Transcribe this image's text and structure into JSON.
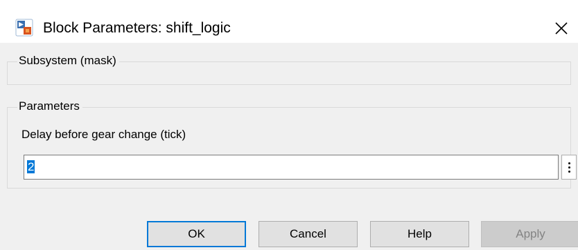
{
  "window": {
    "title": "Block Parameters: shift_logic",
    "app_icon": "simulink-block-icon",
    "close_icon": "close-icon"
  },
  "subsystem_group": {
    "legend": "Subsystem (mask)"
  },
  "parameters_group": {
    "legend": "Parameters",
    "delay_label": "Delay before gear change (tick)",
    "delay_value": "2",
    "more_icon": "vertical-ellipsis-icon"
  },
  "buttons": {
    "ok": "OK",
    "cancel": "Cancel",
    "help": "Help",
    "apply": "Apply"
  },
  "colors": {
    "selection": "#0078d7",
    "default_button_border": "#0078d7",
    "disabled_text": "#838383"
  }
}
